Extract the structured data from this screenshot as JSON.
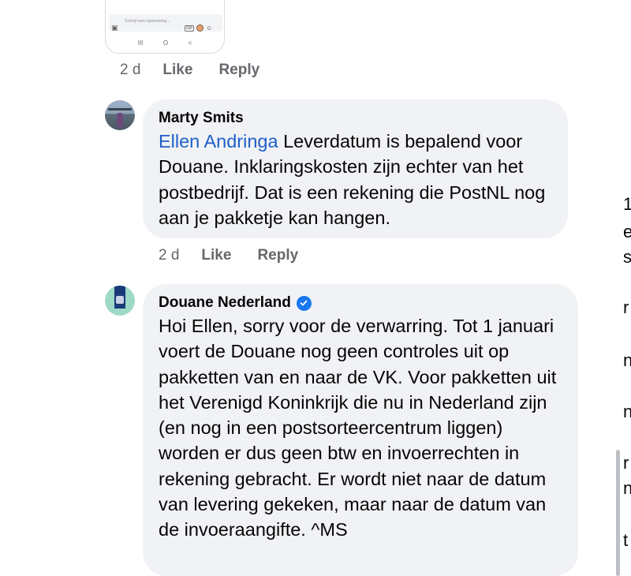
{
  "phone_preview": {
    "composer_placeholder": "Schrijf een opmerking...",
    "gif_label": "GIF",
    "nav_buttons": [
      "III",
      "O",
      "<"
    ]
  },
  "comments": [
    {
      "time": "2 d",
      "like_label": "Like",
      "reply_label": "Reply"
    },
    {
      "author": "Marty Smits",
      "mention": "Ellen Andringa",
      "text": " Leverdatum is bepalend voor Douane. Inklaringskosten zijn echter van het postbedrijf. Dat is een rekening die PostNL nog aan je pakketje kan hangen.",
      "time": "2 d",
      "like_label": "Like",
      "reply_label": "Reply"
    },
    {
      "author": "Douane Nederland",
      "verified": true,
      "text": "Hoi Ellen, sorry voor de verwarring. Tot 1 januari voert de Douane nog geen controles uit op pakketten van en naar de VK. Voor pakketten uit het Verenigd Koninkrijk die nu in Nederland zijn (en nog in een postsorteercentrum liggen) worden er dus geen btw en invoerrechten in rekening gebracht. Er wordt niet naar de datum van levering gekeken, maar naar de datum van de invoeraangifte.  ^MS"
    }
  ],
  "edge_fragments": [
    "1",
    "e",
    "s",
    "r",
    "n",
    "n",
    "r",
    "n",
    "t"
  ],
  "colors": {
    "bubble": "#f0f2f5",
    "mention": "#1e5fc9",
    "meta": "#65676b",
    "verified": "#1877f2"
  }
}
